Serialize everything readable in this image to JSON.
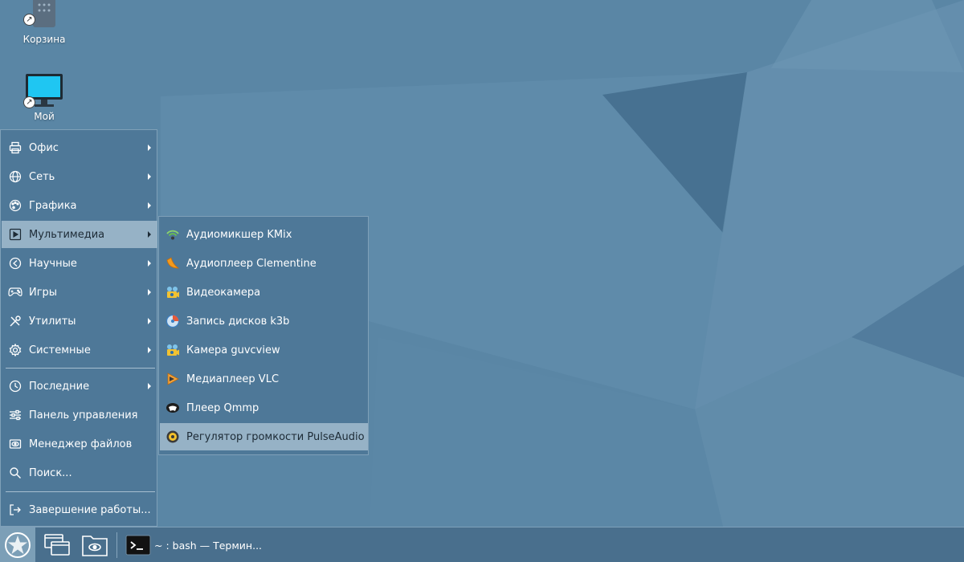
{
  "desktop": {
    "icons": [
      {
        "label": "Корзина",
        "icon": "trash-icon"
      },
      {
        "label": "Мой",
        "icon": "computer-icon"
      }
    ]
  },
  "menu": {
    "items": [
      {
        "label": "Офис",
        "icon": "printer-icon",
        "submenu": true
      },
      {
        "label": "Сеть",
        "icon": "globe-icon",
        "submenu": true
      },
      {
        "label": "Графика",
        "icon": "palette-icon",
        "submenu": true
      },
      {
        "label": "Мультимедиа",
        "icon": "play-icon",
        "submenu": true,
        "active": true
      },
      {
        "label": "Научные",
        "icon": "science-icon",
        "submenu": true
      },
      {
        "label": "Игры",
        "icon": "gamepad-icon",
        "submenu": true
      },
      {
        "label": "Утилиты",
        "icon": "tools-icon",
        "submenu": true
      },
      {
        "label": "Системные",
        "icon": "gear-icon",
        "submenu": true
      },
      {
        "label": "Последние",
        "icon": "clock-icon",
        "submenu": true
      },
      {
        "label": "Панель управления",
        "icon": "sliders-icon",
        "submenu": false
      },
      {
        "label": "Менеджер файлов",
        "icon": "file-manager-icon",
        "submenu": false
      },
      {
        "label": "Поиск...",
        "icon": "search-icon",
        "submenu": false
      },
      {
        "label": "Завершение работы...",
        "icon": "logout-icon",
        "submenu": false
      }
    ]
  },
  "submenu": {
    "items": [
      {
        "label": "Аудиомикшер KMix",
        "icon": "kmix-icon"
      },
      {
        "label": "Аудиоплеер Clementine",
        "icon": "clementine-icon"
      },
      {
        "label": "Видеокамера",
        "icon": "webcam-icon"
      },
      {
        "label": "Запись дисков k3b",
        "icon": "k3b-icon"
      },
      {
        "label": "Камера guvcview",
        "icon": "guvcview-icon"
      },
      {
        "label": "Медиаплеер VLC",
        "icon": "vlc-icon"
      },
      {
        "label": "Плеер Qmmp",
        "icon": "qmmp-icon"
      },
      {
        "label": "Регулятор громкости PulseAudio",
        "icon": "pulseaudio-icon",
        "active": true
      }
    ]
  },
  "taskbar": {
    "task_label": "~ : bash — Термин..."
  },
  "colors": {
    "menu_bg": "#4e7898",
    "highlight": "#96b2c6",
    "desktop_bg": "#5a86a5"
  }
}
